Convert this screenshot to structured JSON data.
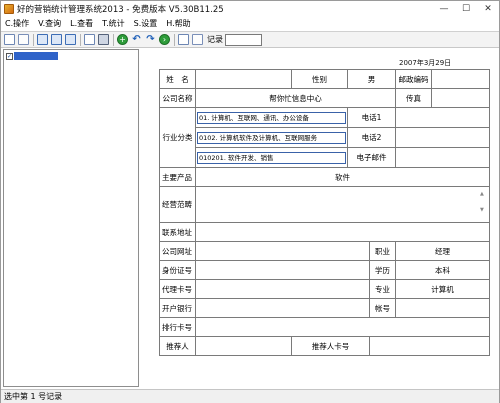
{
  "window": {
    "title": "好的营销统计管理系统2013 - 免费版本 V5.30B11.25",
    "minimize_glyph": "—",
    "maximize_glyph": "☐",
    "close_glyph": "✕"
  },
  "menu": [
    "C.操作",
    "V.查询",
    "L.查看",
    "T.统计",
    "S.设置",
    "H.帮助"
  ],
  "toolbar": {
    "icons": [
      "new-doc-icon",
      "open-doc-icon",
      "grid-view-icon",
      "list-view-icon",
      "card-view-icon",
      "preview-icon",
      "print-icon",
      "add-icon",
      "undo-icon",
      "redo-icon",
      "forward-icon",
      "save-icon",
      "export-icon"
    ],
    "record_label": "记录",
    "record_value": ""
  },
  "tree": {
    "checked": "✓"
  },
  "form": {
    "date": "2007年3月29日",
    "name_label": "姓　名",
    "name_value": "",
    "gender_label": "性别",
    "gender_value": "男",
    "zip_label": "邮政编码",
    "zip_value": "",
    "company_label": "公司名称",
    "company_value": "帮你忙信息中心",
    "fax_label": "传真",
    "fax_value": "",
    "industry_label": "行业分类",
    "industry_items": [
      "01. 计算机、互联网、通讯、办公设备",
      "0102. 计算机软件及计算机、互联网服务",
      "010201. 软件开发、销售"
    ],
    "phone1_label": "电话1",
    "phone2_label": "电话2",
    "email_label": "电子邮件",
    "product_label": "主要产品",
    "product_value": "软件",
    "scope_label": "经营范畴",
    "scope_scroll_up": "▲",
    "scope_scroll_down": "▼",
    "address_label": "联系地址",
    "website_label": "公司网址",
    "position_label": "职业",
    "position_value": "经理",
    "idcard_label": "身份证号",
    "education_label": "学历",
    "education_value": "本科",
    "agent_label": "代理卡号",
    "major_label": "专业",
    "major_value": "计算机",
    "bank_label": "开户银行",
    "account_label": "帐号",
    "sort_label": "排行卡号",
    "referrer_label": "推荐人",
    "referrer_card_label": "推荐人卡号"
  },
  "status": {
    "text": "选中第 1 号记录"
  }
}
